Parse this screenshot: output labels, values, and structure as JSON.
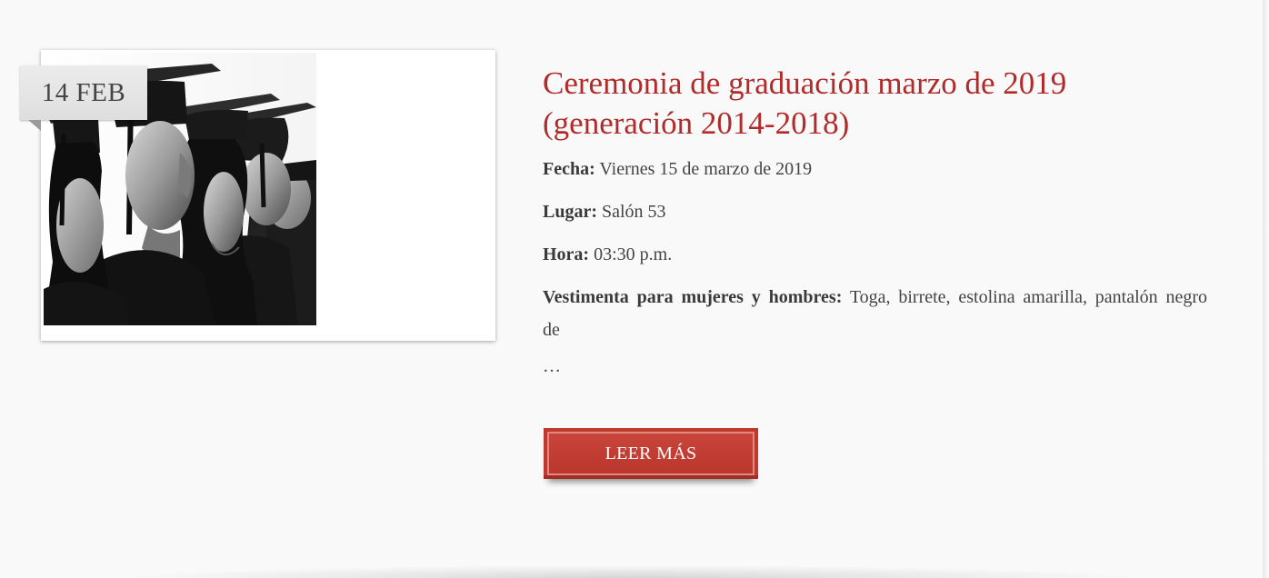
{
  "post": {
    "date_badge": "14 FEB",
    "image": {
      "icon": "graduates-photo",
      "description_icon": "graduates-in-caps-photo"
    },
    "title": "Ceremonia de graduación marzo de 2019 (generación 2014-2018)",
    "fields": {
      "fecha_label": "Fecha:",
      "fecha_value": " Viernes 15 de marzo de 2019",
      "lugar_label": "Lugar:",
      "lugar_value": " Salón 53",
      "hora_label": "Hora:",
      "hora_value": " 03:30 p.m.",
      "vestimenta_label": "Vestimenta para mujeres y hombres:",
      "vestimenta_value": " Toga, birrete, estolina amarilla, pantalón negro de"
    },
    "excerpt_ellipsis": "…",
    "read_more_label": "LEER MÁS"
  },
  "colors": {
    "title": "#b12b2b",
    "button": "#c0392f",
    "badge": "#e4e4e4",
    "background": "#f9f9f9"
  }
}
